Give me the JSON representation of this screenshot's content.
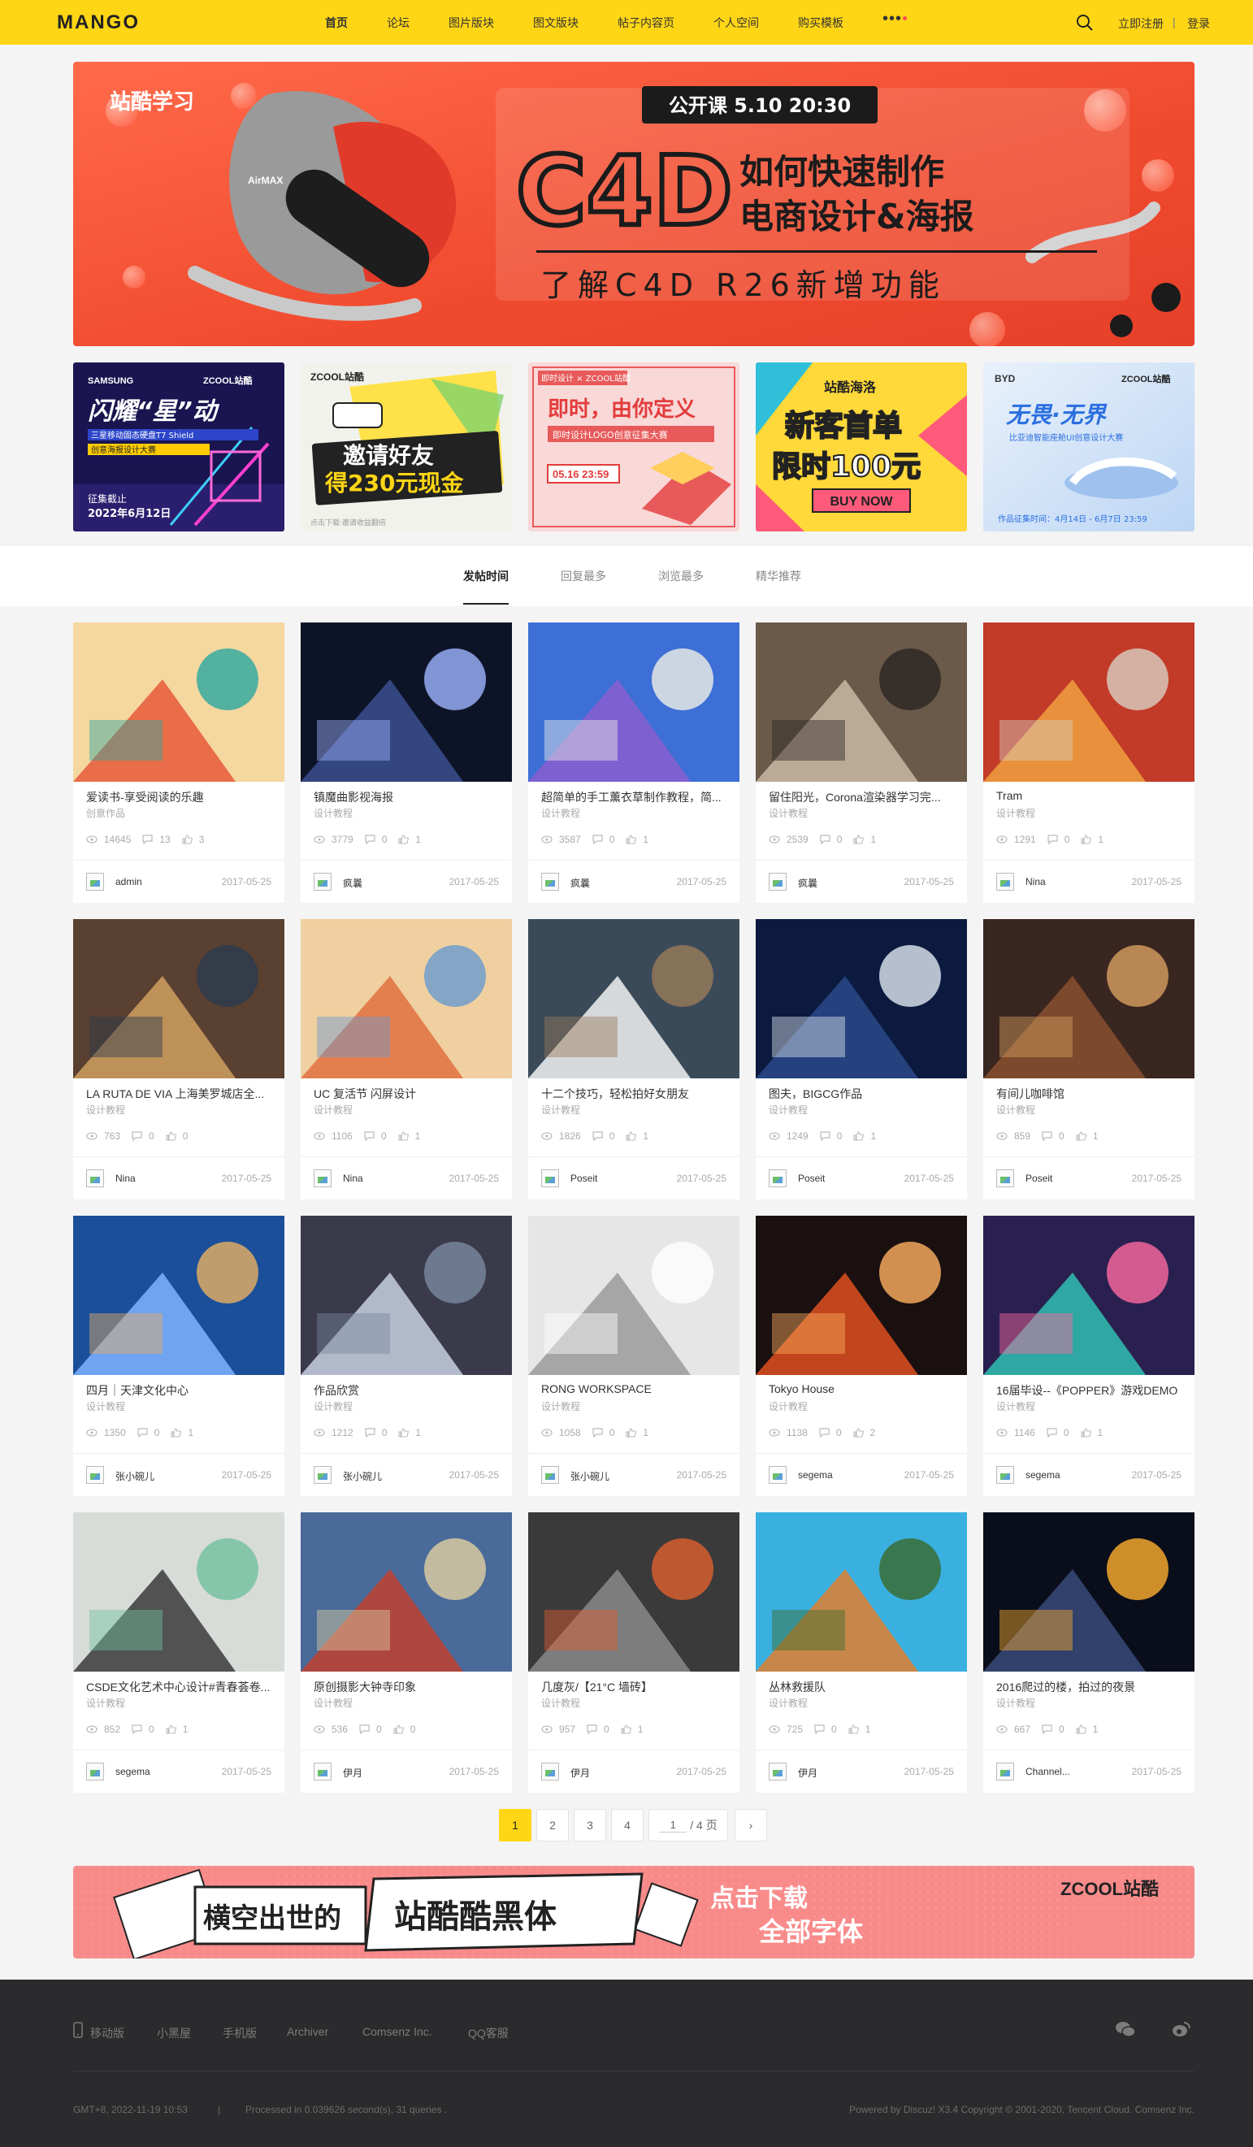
{
  "header": {
    "logo": "MANGO",
    "nav": [
      "首页",
      "论坛",
      "图片版块",
      "图文版块",
      "帖子内容页",
      "个人空间",
      "购买模板"
    ],
    "more": "•••",
    "register": "立即注册",
    "divider": "|",
    "login": "登录"
  },
  "banner": {
    "brand": "站酷学习",
    "schedule": "公开课 5.10 20:30",
    "big": "C4D",
    "line1": "如何快速制作",
    "line2": "电商设计&海报",
    "sub": "了解C4D R26新增功能",
    "shoe": "AirMAX"
  },
  "promos": [
    {
      "brand_left": "SAMSUNG",
      "brand_right": "ZCOOL站酷",
      "title": "闪耀“星”动",
      "sub1": "三星移动固态硬盘T7 Shield",
      "sub2": "创意海报设计大赛",
      "date1": "征集截止",
      "date2": "2022年6月12日"
    },
    {
      "brand": "ZCOOL站酷",
      "title1": "邀请好友",
      "title2": "得230元现金",
      "note": "点击下载·邀请收益翻倍"
    },
    {
      "brand": "即时设计 × ZCOOL站酷",
      "title": "即时，由你定义",
      "sub": "即时设计LOGO创意征集大赛",
      "time": "05.16 23:59"
    },
    {
      "brand": "站酷海洛",
      "title1": "新客首单",
      "title2": "限时100元",
      "cta": "BUY NOW"
    },
    {
      "brand_left": "BYD",
      "brand_right": "ZCOOL站酷",
      "title": "无畏·无界",
      "sub": "比亚迪智能座舱UI创意设计大赛",
      "time": "作品征集时间：4月14日 - 6月7日 23:59"
    }
  ],
  "tabs": [
    "发帖时间",
    "回复最多",
    "浏览最多",
    "精华推荐"
  ],
  "posts": [
    {
      "title": "爱读书-享受阅读的乐趣",
      "cat": "创意作品",
      "views": "14645",
      "replies": "13",
      "likes": "3",
      "author": "admin",
      "date": "2017-05-25"
    },
    {
      "title": "镇魔曲影视海报",
      "cat": "设计教程",
      "views": "3779",
      "replies": "0",
      "likes": "1",
      "author": "疯曩",
      "date": "2017-05-25"
    },
    {
      "title": "超简单的手工薰衣草制作教程，简...",
      "cat": "设计教程",
      "views": "3587",
      "replies": "0",
      "likes": "1",
      "author": "疯曩",
      "date": "2017-05-25"
    },
    {
      "title": "留住阳光，Corona渲染器学习完...",
      "cat": "设计教程",
      "views": "2539",
      "replies": "0",
      "likes": "1",
      "author": "疯曩",
      "date": "2017-05-25"
    },
    {
      "title": "Tram",
      "cat": "设计教程",
      "views": "1291",
      "replies": "0",
      "likes": "1",
      "author": "Nina",
      "date": "2017-05-25"
    },
    {
      "title": "LA RUTA DE VIA 上海美罗城店全...",
      "cat": "设计教程",
      "views": "763",
      "replies": "0",
      "likes": "0",
      "author": "Nina",
      "date": "2017-05-25"
    },
    {
      "title": "UC 复活节 闪屏设计",
      "cat": "设计教程",
      "views": "1106",
      "replies": "0",
      "likes": "1",
      "author": "Nina",
      "date": "2017-05-25"
    },
    {
      "title": "十二个技巧，轻松拍好女朋友",
      "cat": "设计教程",
      "views": "1826",
      "replies": "0",
      "likes": "1",
      "author": "Poseit",
      "date": "2017-05-25"
    },
    {
      "title": "图夫，BIGCG作品",
      "cat": "设计教程",
      "views": "1249",
      "replies": "0",
      "likes": "1",
      "author": "Poseit",
      "date": "2017-05-25"
    },
    {
      "title": "有间儿咖啡馆",
      "cat": "设计教程",
      "views": "859",
      "replies": "0",
      "likes": "1",
      "author": "Poseit",
      "date": "2017-05-25"
    },
    {
      "title": "四月｜天津文化中心",
      "cat": "设计教程",
      "views": "1350",
      "replies": "0",
      "likes": "1",
      "author": "张小碗儿",
      "date": "2017-05-25"
    },
    {
      "title": "作品欣赏",
      "cat": "设计教程",
      "views": "1212",
      "replies": "0",
      "likes": "1",
      "author": "张小碗儿",
      "date": "2017-05-25"
    },
    {
      "title": "RONG WORKSPACE",
      "cat": "设计教程",
      "views": "1058",
      "replies": "0",
      "likes": "1",
      "author": "张小碗儿",
      "date": "2017-05-25"
    },
    {
      "title": "Tokyo House",
      "cat": "设计教程",
      "views": "1138",
      "replies": "0",
      "likes": "2",
      "author": "segema",
      "date": "2017-05-25"
    },
    {
      "title": "16届毕设--《POPPER》游戏DEMO",
      "cat": "设计教程",
      "views": "1146",
      "replies": "0",
      "likes": "1",
      "author": "segema",
      "date": "2017-05-25"
    },
    {
      "title": "CSDE文化艺术中心设计#青春荟卷...",
      "cat": "设计教程",
      "views": "852",
      "replies": "0",
      "likes": "1",
      "author": "segema",
      "date": "2017-05-25"
    },
    {
      "title": "原创摄影大钟寺印象",
      "cat": "设计教程",
      "views": "536",
      "replies": "0",
      "likes": "0",
      "author": "伊月",
      "date": "2017-05-25"
    },
    {
      "title": "几度灰/【21°C 墙砖】",
      "cat": "设计教程",
      "views": "957",
      "replies": "0",
      "likes": "1",
      "author": "伊月",
      "date": "2017-05-25"
    },
    {
      "title": "丛林救援队",
      "cat": "设计教程",
      "views": "725",
      "replies": "0",
      "likes": "1",
      "author": "伊月",
      "date": "2017-05-25"
    },
    {
      "title": "2016爬过的楼，拍过的夜景",
      "cat": "设计教程",
      "views": "667",
      "replies": "0",
      "likes": "1",
      "author": "Channel...",
      "date": "2017-05-25"
    }
  ],
  "pagination": {
    "pages": [
      "1",
      "2",
      "3",
      "4"
    ],
    "current": "1",
    "input_value": "1",
    "total": "/ 4 页",
    "next": "›"
  },
  "font_banner": {
    "left": "横空出世的",
    "main": "站酷酷黑体",
    "cta1": "点击下载",
    "cta2": "全部字体",
    "brand": "ZCOOL站酷"
  },
  "footer": {
    "links": [
      "移动版",
      "小黑屋",
      "手机版",
      "Archiver",
      "Comsenz Inc.",
      "QQ客服"
    ],
    "time": "GMT+8, 2022-11-19 10:53",
    "sep": "|",
    "processed": "Processed in 0.039626 second(s), 31 queries .",
    "powered": "Powered by Discuz! X3.4 Copyright © 2001-2020, Tencent Cloud. Comsenz Inc."
  },
  "colors": {
    "accent": "#ffd615",
    "footer_bg": "#2b2b2d"
  }
}
